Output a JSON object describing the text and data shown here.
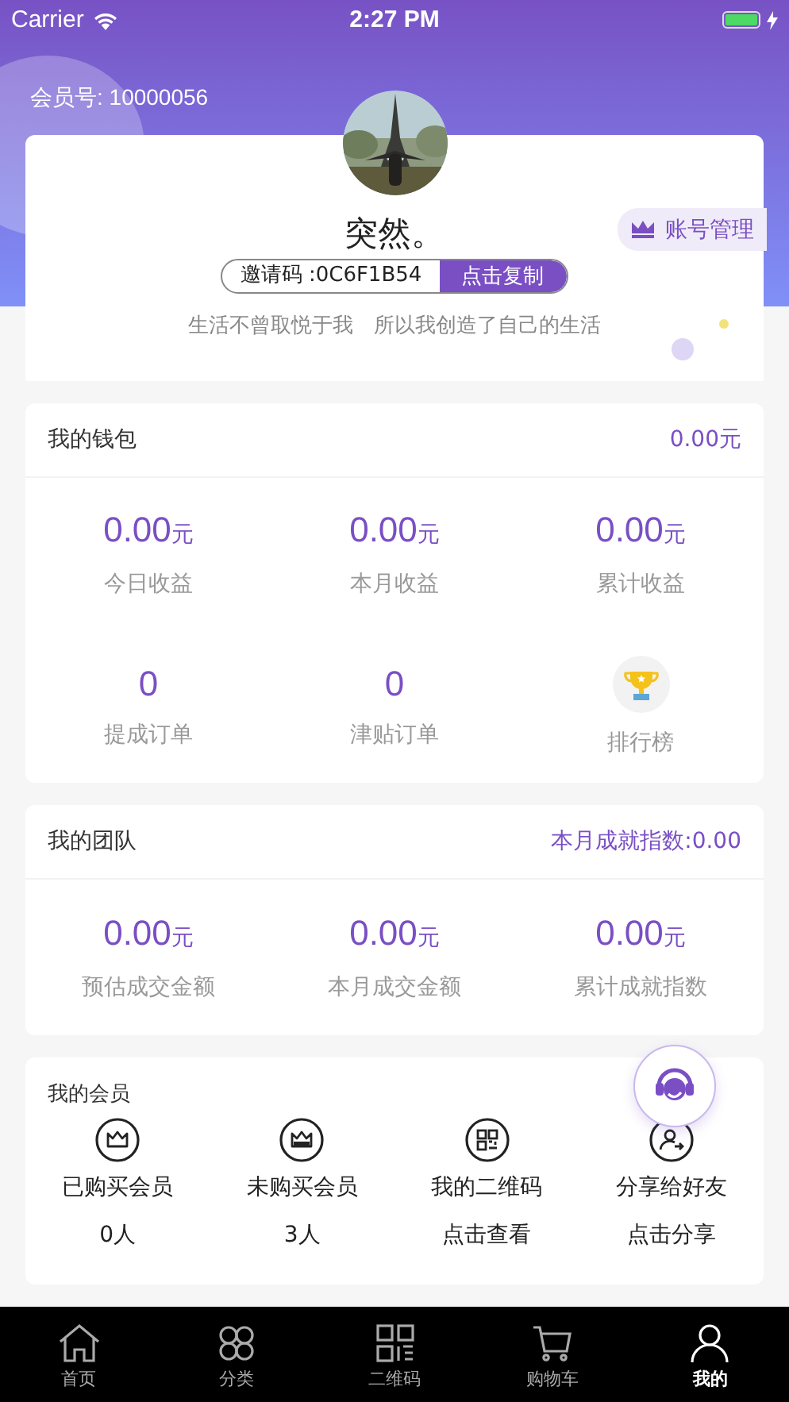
{
  "status": {
    "carrier": "Carrier",
    "time": "2:27 PM"
  },
  "member_no": "会员号: 10000056",
  "profile": {
    "name": "突然。",
    "invite_code": "邀请码 :0C6F1B54",
    "copy_button": "点击复制",
    "motto": "生活不曾取悦于我　所以我创造了自己的生活",
    "account_button": "账号管理"
  },
  "wallet": {
    "title": "我的钱包",
    "total": "0.00元",
    "stats": [
      {
        "kind": "money",
        "value": "0.00",
        "unit": "元",
        "label": "今日收益"
      },
      {
        "kind": "money",
        "value": "0.00",
        "unit": "元",
        "label": "本月收益"
      },
      {
        "kind": "money",
        "value": "0.00",
        "unit": "元",
        "label": "累计收益"
      },
      {
        "kind": "count",
        "value": "0",
        "label": "提成订单"
      },
      {
        "kind": "count",
        "value": "0",
        "label": "津贴订单"
      },
      {
        "kind": "trophy",
        "label": "排行榜"
      }
    ]
  },
  "team": {
    "title": "我的团队",
    "index": "本月成就指数:0.00",
    "stats": [
      {
        "kind": "money",
        "value": "0.00",
        "unit": "元",
        "label": "预估成交金额"
      },
      {
        "kind": "money",
        "value": "0.00",
        "unit": "元",
        "label": "本月成交金额"
      },
      {
        "kind": "money",
        "value": "0.00",
        "unit": "元",
        "label": "累计成就指数"
      }
    ]
  },
  "members": {
    "title": "我的会员",
    "items": [
      {
        "kind": "crown",
        "label": "已购买会员",
        "value": "0人"
      },
      {
        "kind": "crown-filled",
        "label": "未购买会员",
        "value": "3人"
      },
      {
        "kind": "qrcode",
        "label": "我的二维码",
        "value": "点击查看"
      },
      {
        "kind": "share",
        "label": "分享给好友",
        "value": "点击分享"
      }
    ]
  },
  "tabs": [
    {
      "kind": "home",
      "label": "首页",
      "selected": false
    },
    {
      "kind": "category",
      "label": "分类",
      "selected": false
    },
    {
      "kind": "qrcode",
      "label": "二维码",
      "selected": false
    },
    {
      "kind": "cart",
      "label": "购物车",
      "selected": false
    },
    {
      "kind": "user",
      "label": "我的",
      "selected": true
    }
  ]
}
